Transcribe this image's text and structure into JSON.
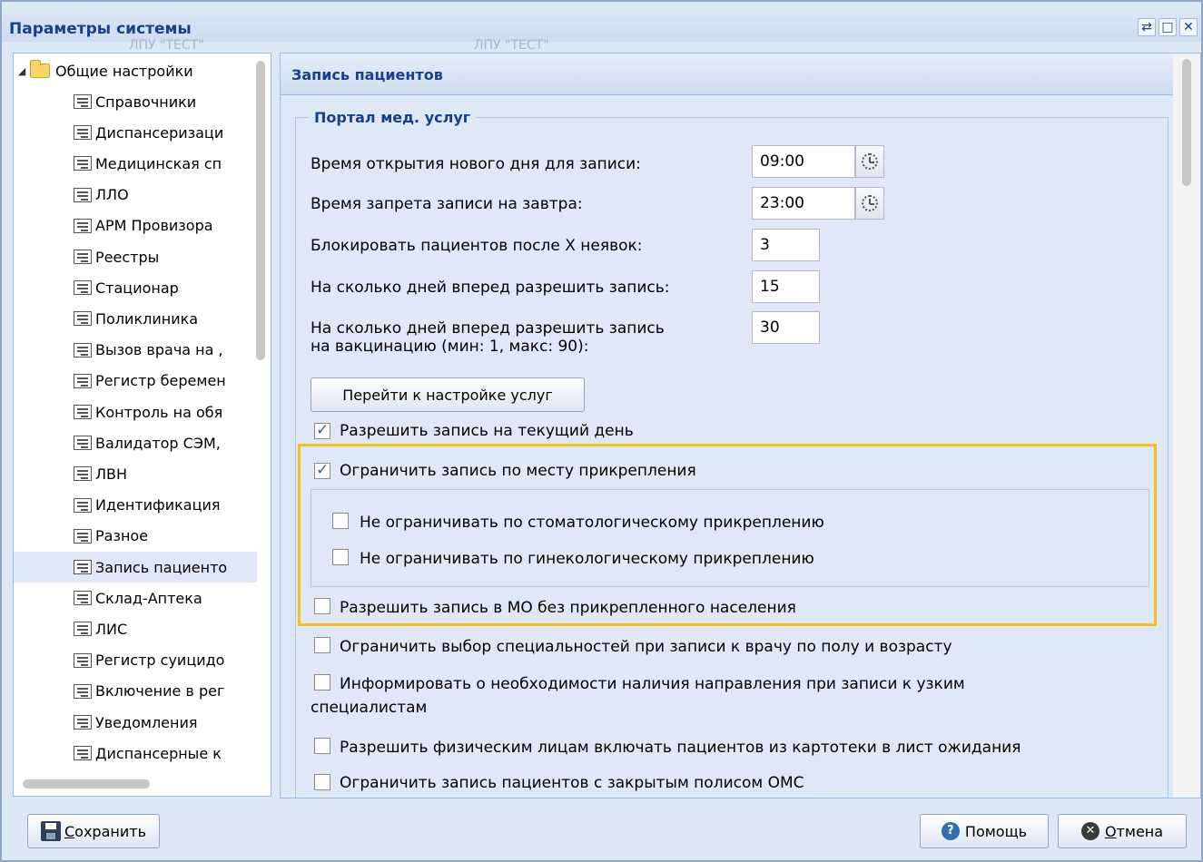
{
  "window": {
    "title": "Параметры системы",
    "ghost_text_1": "ЛПУ \"ТЕСТ\"",
    "ghost_text_2": "ЛПУ \"ТЕСТ\"",
    "buttons": {
      "refresh": "⇄",
      "maximize": "□",
      "close": "✕"
    }
  },
  "tree": {
    "root_label": "Общие настройки",
    "items": [
      {
        "label": "Справочники"
      },
      {
        "label": "Диспансеризаци"
      },
      {
        "label": "Медицинская сп"
      },
      {
        "label": "ЛЛО"
      },
      {
        "label": "АРМ Провизора"
      },
      {
        "label": "Реестры"
      },
      {
        "label": "Стационар"
      },
      {
        "label": "Поликлиника"
      },
      {
        "label": "Вызов врача на ,"
      },
      {
        "label": "Регистр беремен"
      },
      {
        "label": "Контроль на обя"
      },
      {
        "label": "Валидатор СЭМ,"
      },
      {
        "label": "ЛВН"
      },
      {
        "label": "Идентификация"
      },
      {
        "label": "Разное"
      },
      {
        "label": "Запись пациенто"
      },
      {
        "label": "Склад-Аптека"
      },
      {
        "label": "ЛИС"
      },
      {
        "label": "Регистр суицидо"
      },
      {
        "label": "Включение в рег"
      },
      {
        "label": "Уведомления"
      },
      {
        "label": "Диспансерные к"
      }
    ],
    "selected_index": 15
  },
  "panel": {
    "title": "Запись пациентов",
    "fieldset_legend": "Портал мед. услуг",
    "fields": {
      "open_time": {
        "label": "Время открытия нового дня для записи:",
        "value": "09:00"
      },
      "ban_time": {
        "label": "Время запрета записи на завтра:",
        "value": "23:00"
      },
      "block_after": {
        "label": "Блокировать пациентов после X неявок:",
        "value": "3"
      },
      "days_ahead": {
        "label": "На сколько дней вперед разрешить запись:",
        "value": "15"
      },
      "vacc_days_line1": "На сколько дней вперед разрешить запись",
      "vacc_days_line2": "на вакцинацию (мин: 1, макс: 90):",
      "vacc_days_value": "30"
    },
    "goto_services_button": "Перейти к настройке услуг",
    "checkboxes": {
      "allow_today": {
        "label": "Разрешить запись на текущий день",
        "checked": true
      },
      "restrict_attachment": {
        "label": "Ограничить запись по месту прикрепления",
        "checked": true
      },
      "no_restrict_dental": {
        "label": "Не ограничивать по стоматологическому прикреплению",
        "checked": false
      },
      "no_restrict_gyn": {
        "label": "Не ограничивать по гинекологическому прикреплению",
        "checked": false
      },
      "allow_mo_no_pop": {
        "label": "Разрешить запись в МО без прикрепленного населения",
        "checked": false
      },
      "restrict_specialties": {
        "label": "Ограничить выбор специальностей при записи к врачу по полу и возрасту",
        "checked": false
      },
      "inform_referral_line1": "Информировать о необходимости наличия направления при записи к узким",
      "inform_referral_line2": "специалистам",
      "allow_waitlist": {
        "label": "Разрешить физическим лицам включать пациентов из картотеки в лист ожидания",
        "checked": false
      },
      "restrict_closed_policy": {
        "label": "Ограничить запись пациентов с закрытым полисом ОМС",
        "checked": false
      }
    }
  },
  "footer": {
    "save_label": "Сохранить",
    "help_label": "Помощь",
    "cancel_label": "Отмена",
    "help_glyph": "?",
    "cancel_glyph": "✕"
  },
  "colors": {
    "title_text": "#15428b",
    "highlight_border": "#f4c01e",
    "panel_bg": "#dfe8f6"
  }
}
